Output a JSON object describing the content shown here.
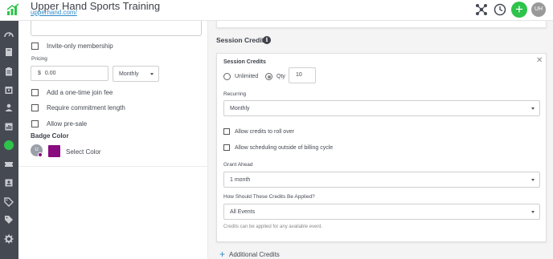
{
  "header": {
    "title": "Upper Hand Sports Training",
    "subtitle": "upperhand.com/",
    "plus_label": "+",
    "user_initials": "UH"
  },
  "sidebar": {
    "items": [
      "dashboard-icon",
      "book-icon",
      "clipboard-icon",
      "calendar-icon",
      "users-icon",
      "chart-icon",
      "memberships-icon",
      "ticket-icon",
      "contacts-icon",
      "tag-icon",
      "tag-outline-icon",
      "gear-icon"
    ]
  },
  "membership_form": {
    "invite_only_label": "Invite-only membership",
    "pricing_label": "Pricing",
    "currency_symbol": "$",
    "price_value": "0.00",
    "interval_value": "Monthly",
    "join_fee_label": "Add a one-time join fee",
    "commitment_label": "Require commitment length",
    "presale_label": "Allow pre-sale",
    "badge_color_label": "Badge Color",
    "badge_initials": "U",
    "badge_color": "#8a0b7e",
    "select_color_label": "Select Color"
  },
  "session_credits": {
    "section_title": "Session Credits",
    "info_glyph": "i",
    "card_title": "Session Credits",
    "close_glyph": "✕",
    "unlimited_label": "Unlimited",
    "qty_label": "Qty",
    "qty_value": "10",
    "recurring_label": "Recurring",
    "recurring_value": "Monthly",
    "rollover_label": "Allow credits to roll over",
    "outside_billing_label": "Allow scheduling outside of billing cycle",
    "grant_ahead_label": "Grant Ahead",
    "grant_ahead_value": "1 month",
    "applied_label": "How Should These Credits Be Applied?",
    "applied_value": "All Events",
    "help_text": "Credits can be applied for any available event.",
    "add_plus": "+",
    "add_label": "Additional Credits"
  },
  "colors": {
    "accent_green": "#2ec34a",
    "sidebar_bg": "#454952",
    "link_blue": "#2f8ac8"
  }
}
